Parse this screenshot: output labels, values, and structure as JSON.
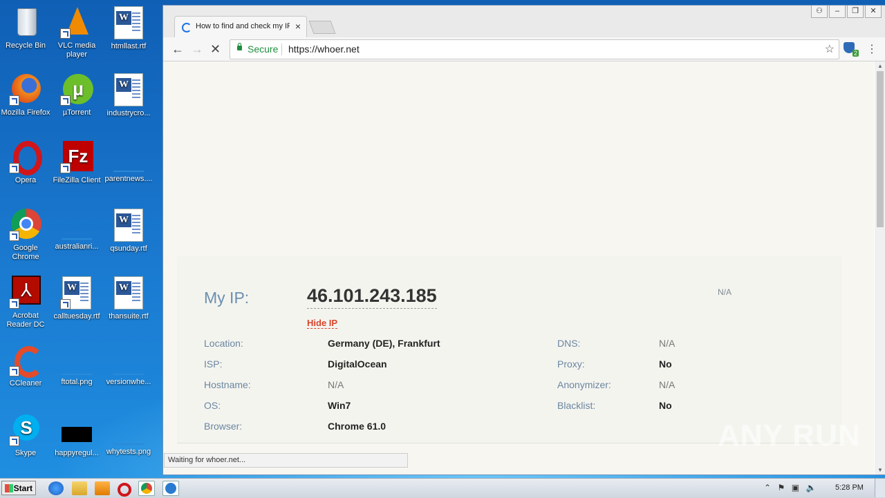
{
  "desktop": {
    "icons": [
      {
        "label": "Recycle Bin"
      },
      {
        "label": "VLC media player"
      },
      {
        "label": "htmllast.rtf"
      },
      {
        "label": "Mozilla Firefox"
      },
      {
        "label": "µTorrent"
      },
      {
        "label": "industrycro..."
      },
      {
        "label": "Opera"
      },
      {
        "label": "FileZilla Client"
      },
      {
        "label": "parentnews...."
      },
      {
        "label": "Google Chrome"
      },
      {
        "label": "australianri..."
      },
      {
        "label": "qsunday.rtf"
      },
      {
        "label": "Acrobat Reader DC"
      },
      {
        "label": "calltuesday.rtf"
      },
      {
        "label": "thansuite.rtf"
      },
      {
        "label": "CCleaner"
      },
      {
        "label": "ftotal.png"
      },
      {
        "label": "versionwhe..."
      },
      {
        "label": "Skype"
      },
      {
        "label": "happyregul..."
      },
      {
        "label": "whytests.png"
      }
    ]
  },
  "browser": {
    "tab_title": "How to find and check my IP",
    "secure_label": "Secure",
    "url": "https://whoer.net",
    "status_text": "Waiting for whoer.net...",
    "extension_badge": "2"
  },
  "page": {
    "my_ip_label": "My IP:",
    "my_ip_value": "46.101.243.185",
    "hide_ip_label": "Hide IP",
    "top_right_na": "N/A",
    "left_rows": [
      {
        "label": "Location:",
        "value": "Germany (DE), Frankfurt"
      },
      {
        "label": "ISP:",
        "value": "DigitalOcean"
      },
      {
        "label": "Hostname:",
        "value": "N/A"
      },
      {
        "label": "OS:",
        "value": "Win7"
      },
      {
        "label": "Browser:",
        "value": "Chrome 61.0"
      }
    ],
    "right_rows": [
      {
        "label": "DNS:",
        "value": "N/A"
      },
      {
        "label": "Proxy:",
        "value": "No"
      },
      {
        "label": "Anonymizer:",
        "value": "N/A"
      },
      {
        "label": "Blacklist:",
        "value": "No"
      }
    ]
  },
  "watermark": "ANY RUN",
  "taskbar": {
    "start_label": "Start",
    "clock": "5:28 PM"
  }
}
